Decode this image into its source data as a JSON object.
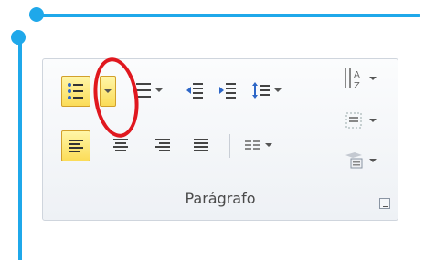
{
  "ribbon": {
    "group_label": "Parágrafo"
  },
  "colors": {
    "callout_blue": "#1fa8ea",
    "highlight_red": "#e0181f",
    "active_button": "#fbdc58"
  },
  "icons": [
    "bullet-list-icon",
    "bullet-list-dropdown-icon",
    "numbered-list-icon",
    "decrease-indent-icon",
    "increase-indent-icon",
    "line-spacing-icon",
    "sort-icon",
    "align-left-icon",
    "center-icon",
    "align-right-icon",
    "justify-icon",
    "columns-icon",
    "shading-icon",
    "borders-icon",
    "dialog-launcher-icon"
  ]
}
